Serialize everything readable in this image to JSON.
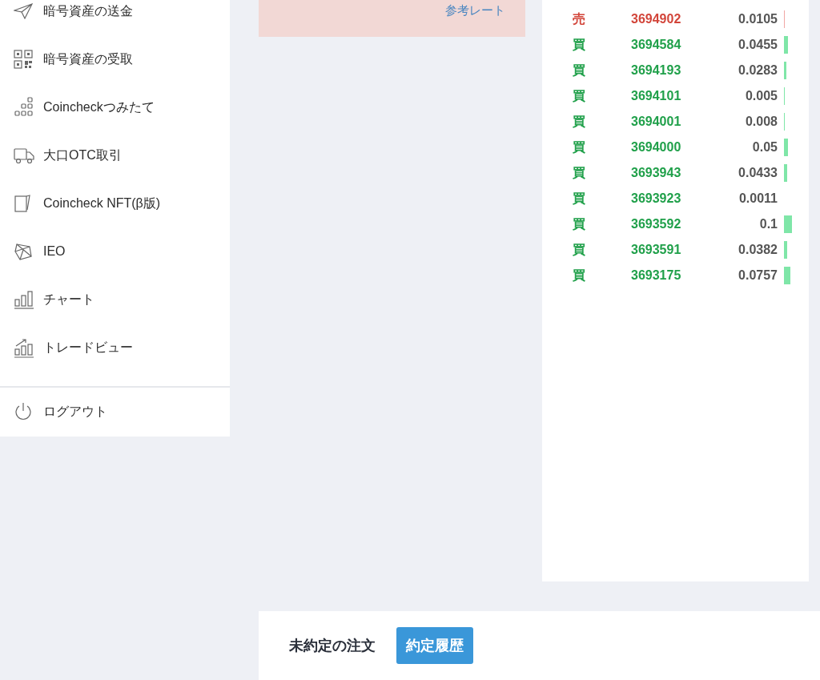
{
  "sidebar": {
    "items": [
      {
        "label": "暗号資産の送金"
      },
      {
        "label": "暗号資産の受取"
      },
      {
        "label": "Coincheckつみたて"
      },
      {
        "label": "大口OTC取引"
      },
      {
        "label": "Coincheck NFT(β版)"
      },
      {
        "label": "IEO"
      },
      {
        "label": "チャート"
      },
      {
        "label": "トレードビュー"
      }
    ],
    "logout": "ログアウト"
  },
  "rate_panel": {
    "link": "参考レート"
  },
  "trades": [
    {
      "side": "売",
      "kind": "sell",
      "price": "3694902",
      "amount": "0.0105"
    },
    {
      "side": "買",
      "kind": "buy",
      "price": "3694584",
      "amount": "0.0455"
    },
    {
      "side": "買",
      "kind": "buy",
      "price": "3694193",
      "amount": "0.0283"
    },
    {
      "side": "買",
      "kind": "buy",
      "price": "3694101",
      "amount": "0.005"
    },
    {
      "side": "買",
      "kind": "buy",
      "price": "3694001",
      "amount": "0.008"
    },
    {
      "side": "買",
      "kind": "buy",
      "price": "3694000",
      "amount": "0.05"
    },
    {
      "side": "買",
      "kind": "buy",
      "price": "3693943",
      "amount": "0.0433"
    },
    {
      "side": "買",
      "kind": "buy",
      "price": "3693923",
      "amount": "0.0011"
    },
    {
      "side": "買",
      "kind": "buy",
      "price": "3693592",
      "amount": "0.1"
    },
    {
      "side": "買",
      "kind": "buy",
      "price": "3693591",
      "amount": "0.0382"
    },
    {
      "side": "買",
      "kind": "buy",
      "price": "3693175",
      "amount": "0.0757"
    }
  ],
  "order_tabs": [
    {
      "label": "未約定の注文",
      "selected": false
    },
    {
      "label": "約定履歴",
      "selected": true
    }
  ]
}
